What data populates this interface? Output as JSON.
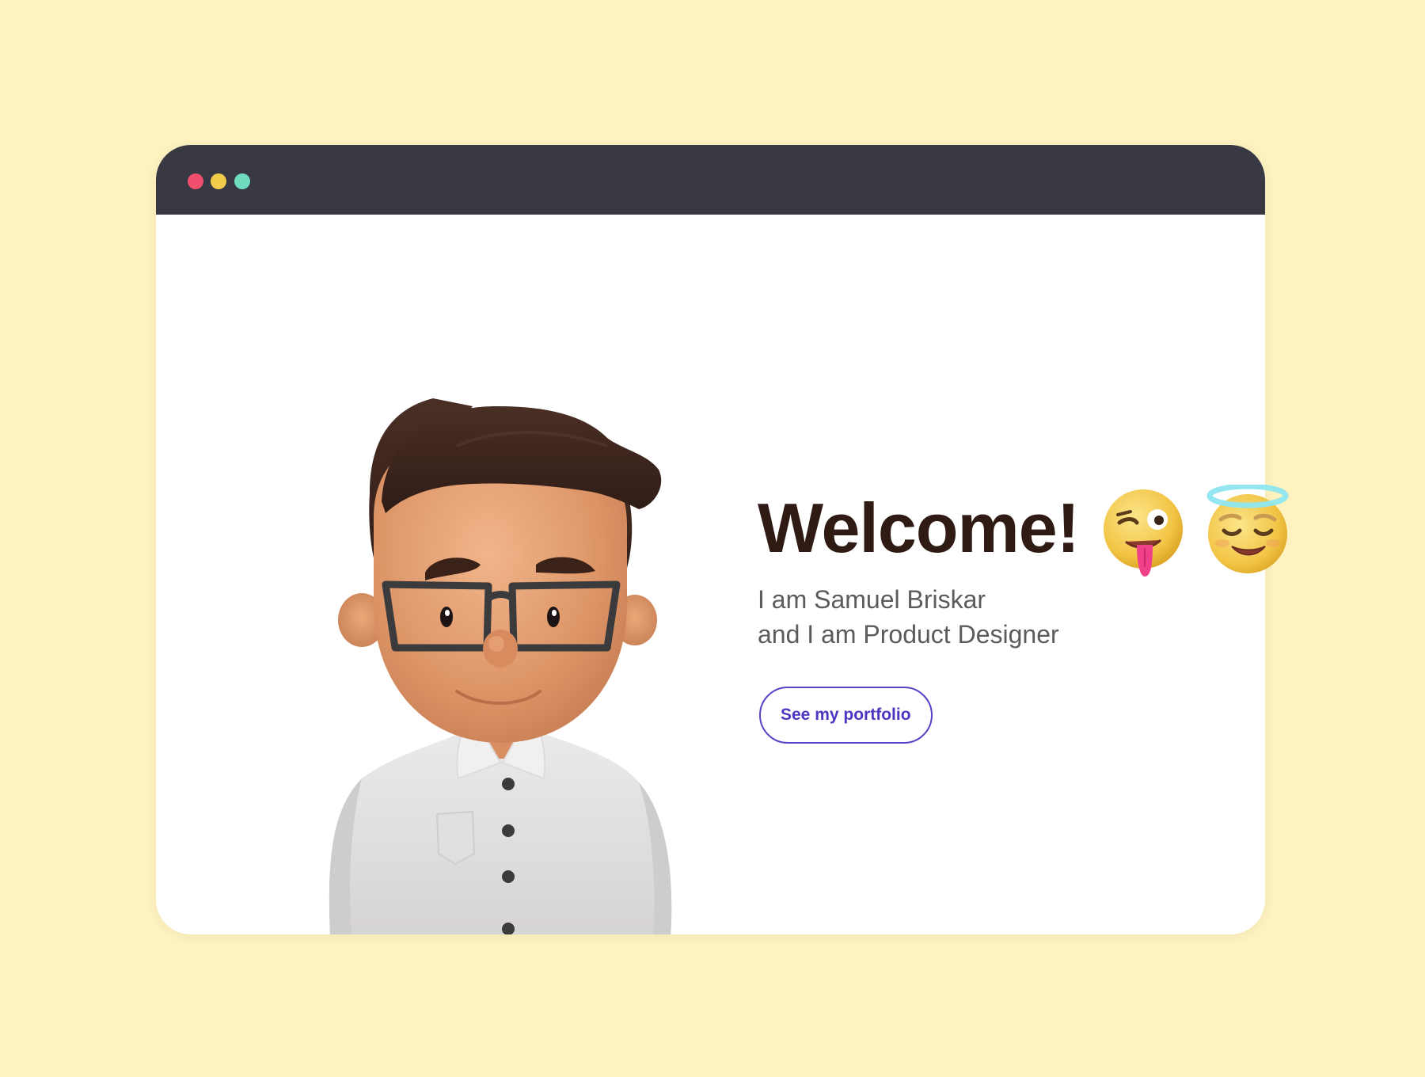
{
  "window": {
    "controls": [
      {
        "name": "close-dot",
        "color": "#f0506e"
      },
      {
        "name": "minimize-dot",
        "color": "#f2cc4b"
      },
      {
        "name": "maximize-dot",
        "color": "#6fdcbd"
      }
    ],
    "titlebar_color": "#383843"
  },
  "hero": {
    "title": "Welcome!",
    "intro_line1": "I am Samuel Briskar",
    "intro_line2": "and I am Product Designer",
    "cta_label": "See my portfolio"
  },
  "illustration": {
    "avatar": "3d-character-with-glasses",
    "emojis": [
      "winking-tongue-emoji",
      "smiling-halo-emoji"
    ]
  },
  "colors": {
    "page_background": "#fdf2c0",
    "title": "#2f1a14",
    "body_text": "#5b5b5b",
    "accent": "#5b3fc6"
  }
}
